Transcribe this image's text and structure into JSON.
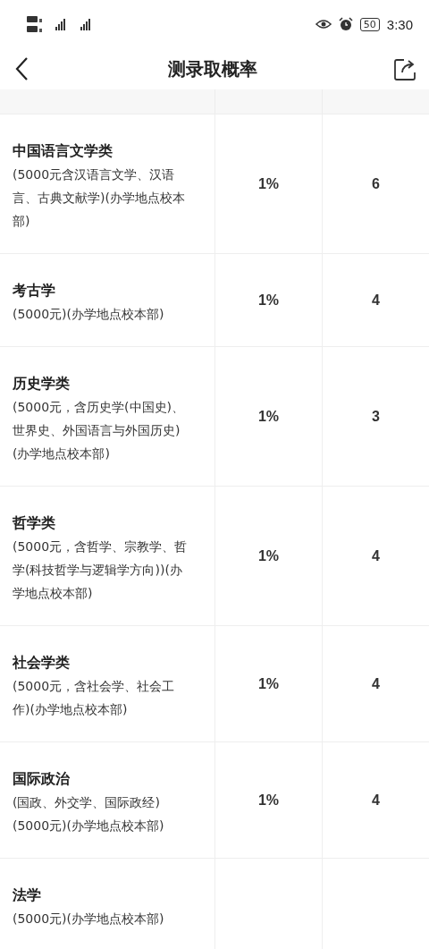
{
  "status_bar": {
    "battery": "50",
    "time": "3:30"
  },
  "nav": {
    "title": "测录取概率"
  },
  "rows": [
    {
      "name": "中国语言文学类",
      "desc_lines": [
        "(5000元含汉语言文学、汉语",
        "言、古典文献学)(办学地点校本",
        "部)"
      ],
      "ratio": "1%",
      "count": "6"
    },
    {
      "name": "考古学",
      "desc_lines": [
        "(5000元)(办学地点校本部)"
      ],
      "ratio": "1%",
      "count": "4"
    },
    {
      "name": "历史学类",
      "desc_lines": [
        "(5000元，含历史学(中国史)、",
        "世界史、外国语言与外国历史)",
        "(办学地点校本部)"
      ],
      "ratio": "1%",
      "count": "3"
    },
    {
      "name": "哲学类",
      "desc_lines": [
        "(5000元，含哲学、宗教学、哲",
        "学(科技哲学与逻辑学方向))(办",
        "学地点校本部)"
      ],
      "ratio": "1%",
      "count": "4"
    },
    {
      "name": "社会学类",
      "desc_lines": [
        "(5000元，含社会学、社会工",
        "作)(办学地点校本部)"
      ],
      "ratio": "1%",
      "count": "4"
    },
    {
      "name": "国际政治",
      "desc_lines": [
        "(国政、外交学、国际政经)",
        "(5000元)(办学地点校本部)"
      ],
      "ratio": "1%",
      "count": "4"
    },
    {
      "name": "法学",
      "desc_lines": [
        "(5000元)(办学地点校本部)"
      ]
    }
  ]
}
